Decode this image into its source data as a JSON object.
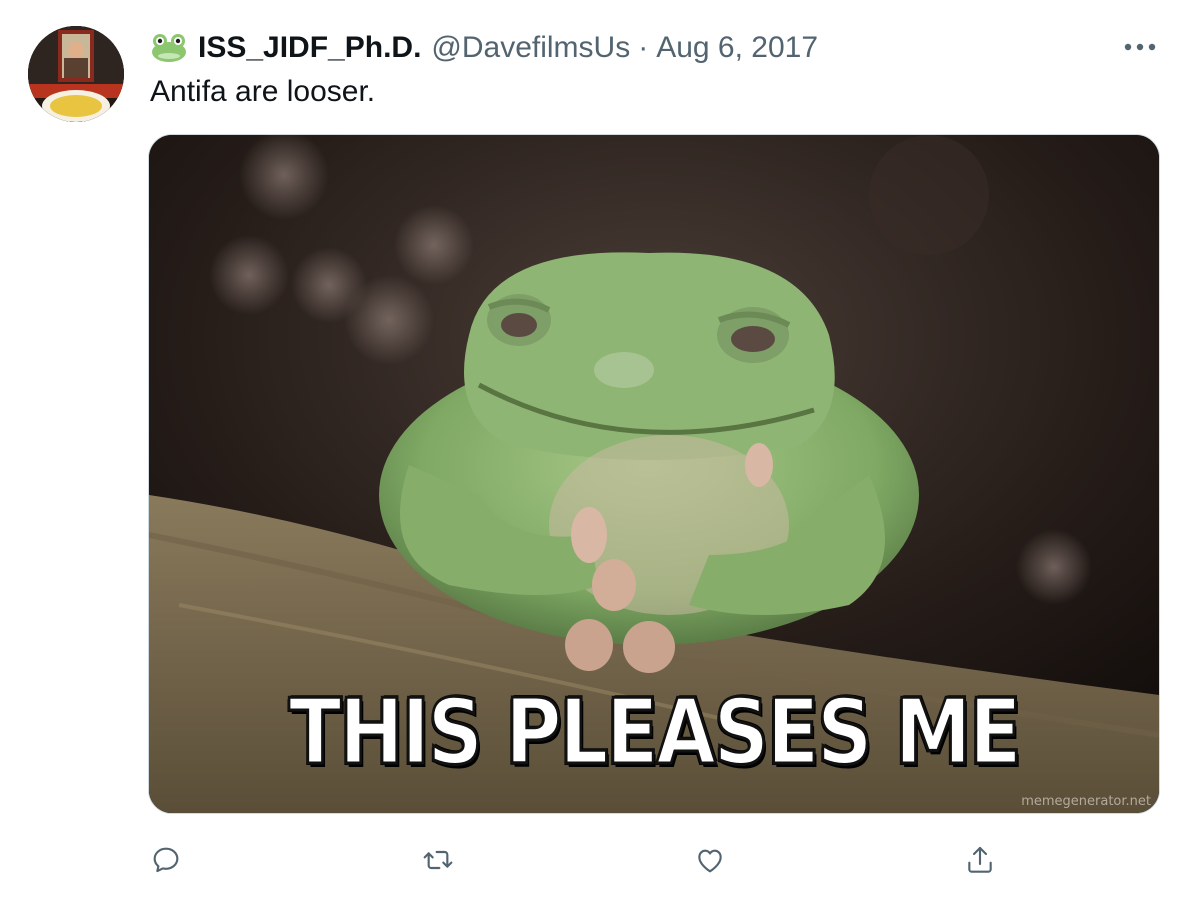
{
  "tweet": {
    "display_name": "ISS_JIDF_Ph.D.",
    "handle": "@DavefilmsUs",
    "separator": "·",
    "date": "Aug 6, 2017",
    "text": "Antifa are looser.",
    "name_emoji": "frog-face-icon",
    "media": {
      "caption": "THIS PLEASES ME",
      "watermark": "memegenerator.net"
    },
    "actions": [
      {
        "name": "reply",
        "icon": "reply-icon"
      },
      {
        "name": "retweet",
        "icon": "retweet-icon"
      },
      {
        "name": "like",
        "icon": "heart-icon"
      },
      {
        "name": "share",
        "icon": "share-icon"
      }
    ]
  },
  "colors": {
    "text_primary": "#0f1419",
    "text_secondary": "#536471",
    "border": "#cfd9de"
  }
}
